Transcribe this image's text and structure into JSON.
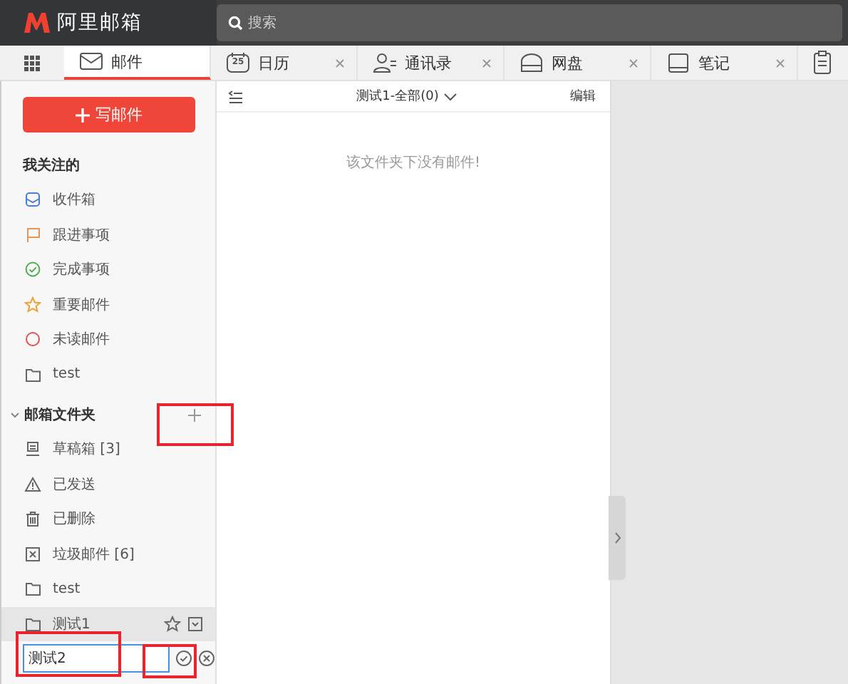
{
  "header": {
    "logo_text": "阿里邮箱",
    "search": {
      "placeholder": "搜索"
    }
  },
  "tabs": [
    {
      "label": "邮件",
      "kind": "mail",
      "selected": true,
      "closable": false
    },
    {
      "label": "日历",
      "kind": "calendar",
      "icon_text": "25",
      "selected": false,
      "closable": true
    },
    {
      "label": "通讯录",
      "kind": "contacts",
      "selected": false,
      "closable": true
    },
    {
      "label": "网盘",
      "kind": "drive",
      "selected": false,
      "closable": true
    },
    {
      "label": "笔记",
      "kind": "notes",
      "selected": false,
      "closable": true
    }
  ],
  "sidebar": {
    "compose_button": "写邮件",
    "favorites": {
      "title": "我关注的",
      "items": [
        {
          "label": "收件箱",
          "kind": "inbox"
        },
        {
          "label": "跟进事项",
          "kind": "flag"
        },
        {
          "label": "完成事项",
          "kind": "check"
        },
        {
          "label": "重要邮件",
          "kind": "star"
        },
        {
          "label": "未读邮件",
          "kind": "circle"
        },
        {
          "label": "test",
          "kind": "folder"
        }
      ]
    },
    "folders": {
      "title": "邮箱文件夹",
      "expanded": true,
      "add_highlighted": true,
      "items": [
        {
          "label": "草稿箱 [3]",
          "kind": "drafts",
          "hovered": false
        },
        {
          "label": "已发送",
          "kind": "sent",
          "hovered": false
        },
        {
          "label": "已删除",
          "kind": "trash",
          "hovered": false
        },
        {
          "label": "垃圾邮件 [6]",
          "kind": "spam",
          "hovered": false
        },
        {
          "label": "test",
          "kind": "folder",
          "hovered": false
        },
        {
          "label": "测试1",
          "kind": "folder",
          "hovered": true
        }
      ],
      "new_folder": {
        "value": "测试2",
        "highlighted": true,
        "confirm_highlighted": true
      }
    }
  },
  "mail_list": {
    "title": "测试1-全部(0)",
    "edit": "编辑",
    "empty_message": "该文件夹下没有邮件!"
  }
}
